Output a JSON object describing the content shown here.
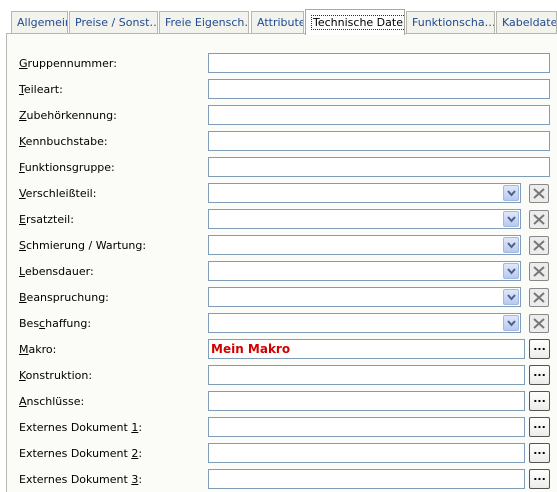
{
  "tabs": [
    {
      "label": "Allgemein",
      "active": false
    },
    {
      "label": "Preise / Sonst…",
      "active": false
    },
    {
      "label": "Freie Eigensch…",
      "active": false
    },
    {
      "label": "Attribute",
      "active": false
    },
    {
      "label": "Technische Daten",
      "active": true
    },
    {
      "label": "Funktionscha…",
      "active": false
    },
    {
      "label": "Kabeldaten",
      "active": false
    }
  ],
  "fields": {
    "gruppennummer": {
      "label_u": "G",
      "label_rest": "ruppennummer:",
      "value": ""
    },
    "teileart": {
      "label_u": "T",
      "label_rest": "eileart:",
      "value": ""
    },
    "zubehoerkennung": {
      "label_u": "Z",
      "label_rest": "ubehörkennung:",
      "value": ""
    },
    "kennbuchstabe": {
      "label_u": "K",
      "label_rest": "ennbuchstabe:",
      "value": ""
    },
    "funktionsgruppe": {
      "label_u": "F",
      "label_rest": "unktionsgruppe:",
      "value": ""
    },
    "verschleissteil": {
      "label_u": "V",
      "label_rest": "erschleißteil:",
      "value": ""
    },
    "ersatzteil": {
      "label_u": "E",
      "label_rest": "rsatzteil:",
      "value": ""
    },
    "schmierung": {
      "label_u": "S",
      "label_rest": "chmierung / Wartung:",
      "value": ""
    },
    "lebensdauer": {
      "label_u": "L",
      "label_rest": "ebensdauer:",
      "value": ""
    },
    "beanspruchung": {
      "label_u": "B",
      "label_rest": "eanspruchung:",
      "value": ""
    },
    "beschaffung_pre": "Bes",
    "beschaffung_u": "c",
    "beschaffung_rest": "haffung:",
    "makro": {
      "label_u": "M",
      "label_rest": "akro:",
      "value": "Mein Makro"
    },
    "konstruktion": {
      "label_u": "K",
      "label_rest": "onstruktion:",
      "value": ""
    },
    "anschluesse": {
      "label_u": "A",
      "label_rest": "nschlüsse:",
      "value": ""
    },
    "extdoc1": {
      "label_pre": "Externes Dokument ",
      "label_u": "1",
      "label_rest": ":",
      "value": ""
    },
    "extdoc2": {
      "label_pre": "Externes Dokument ",
      "label_u": "2",
      "label_rest": ":",
      "value": ""
    },
    "extdoc3": {
      "label_pre": "Externes Dokument ",
      "label_u": "3",
      "label_rest": ":",
      "value": ""
    }
  },
  "browse_label": "...",
  "icons": {
    "dropdown": "chevron-down-icon",
    "clear": "clear-x-icon"
  },
  "colors": {
    "tab_text": "#1f4a8f",
    "field_border": "#7f9db9",
    "macro_value": "#d40000"
  }
}
